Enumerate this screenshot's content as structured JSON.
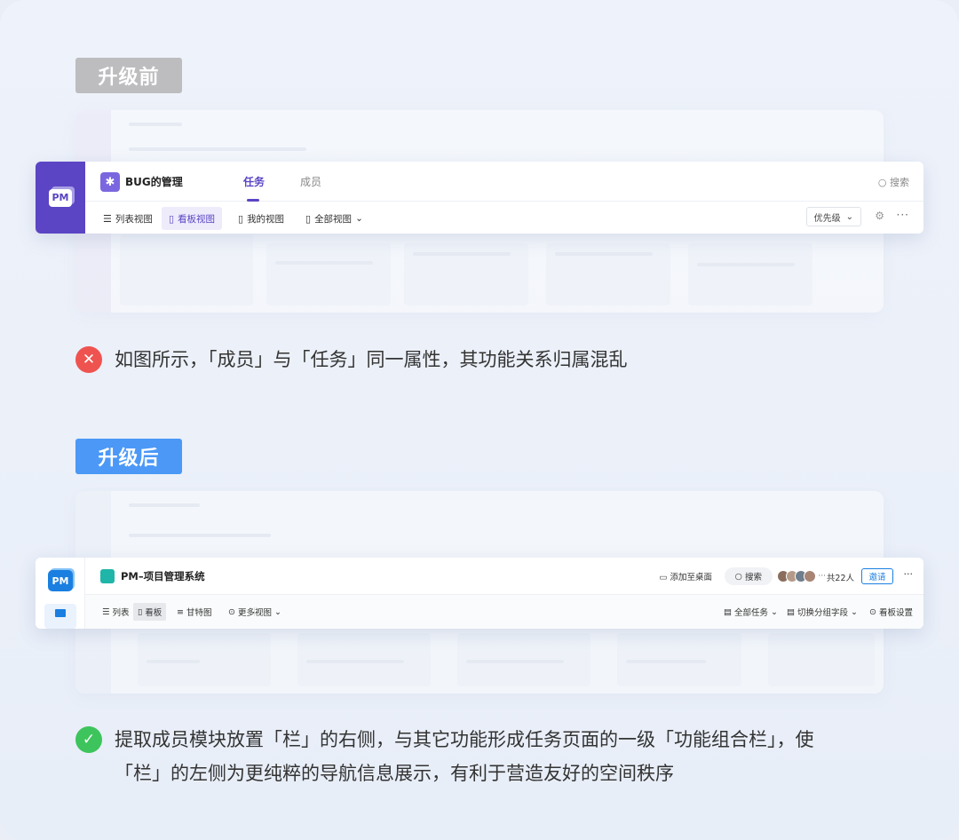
{
  "before": {
    "tag": "升级前",
    "logo": "PM",
    "project_name": "BUG的管理",
    "tabs": [
      "任务",
      "成员"
    ],
    "search": "搜索",
    "views": [
      "列表视图",
      "看板视图",
      "我的视图",
      "全部视图"
    ],
    "priority": "优先级",
    "note": "如图所示，「成员」与「任务」同一属性，其功能关系归属混乱"
  },
  "after": {
    "tag": "升级后",
    "logo": "PM",
    "project_name": "PM–项目管理系统",
    "add_desktop": "添加至桌面",
    "search": "搜索",
    "member_count": "共22人",
    "invite": "邀请",
    "views": [
      "列表",
      "看板",
      "甘特图",
      "更多视图"
    ],
    "right_actions": [
      "全部任务",
      "切换分组字段",
      "看板设置"
    ],
    "note": "提取成员模块放置「栏」的右侧，与其它功能形成任务页面的一级「功能组合栏」，使「栏」的左侧为更纯粹的导航信息展示，有利于营造友好的空间秩序"
  },
  "colors": {
    "before_accent": "#5b45c4",
    "after_accent": "#1a7fe0",
    "tag_before": "#bdbdc0",
    "tag_after": "#4b98f7",
    "error": "#ef5350",
    "success": "#3ec45c"
  },
  "icons": [
    "bug-icon",
    "search-icon",
    "list-icon",
    "kanban-icon",
    "user-view-icon",
    "all-views-icon",
    "chevron-down-icon",
    "gear-icon",
    "more-icon",
    "desktop-icon",
    "gantt-icon",
    "filter-icon",
    "group-icon",
    "settings-icon",
    "close-icon",
    "check-icon"
  ]
}
